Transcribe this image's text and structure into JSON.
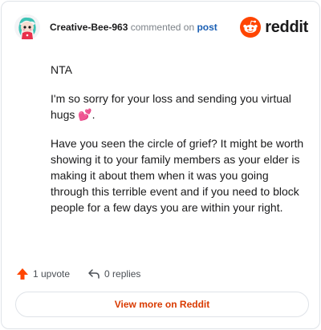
{
  "header": {
    "username": "Creative-Bee-963",
    "action_text": "commented on",
    "post_link": "post",
    "brand_name": "reddit"
  },
  "comment": {
    "paragraphs": [
      "NTA",
      "I'm so sorry for your loss and sending you virtual hugs 💕.",
      "Have you seen the circle of grief? It might be worth showing it to your family members as your elder is making it about them when it was you going through this terrible event and if you need to block people for a few days you are within your right."
    ]
  },
  "actions": {
    "upvotes": "1 upvote",
    "replies": "0 replies"
  },
  "footer": {
    "view_more_label": "View more on Reddit"
  },
  "colors": {
    "brand_orange": "#ff4500",
    "link_blue": "#1a5fb4",
    "cta_text": "#d93a00",
    "upvote_icon": "#ff4500"
  },
  "icons": {
    "avatar": "snoo-avatar-icon",
    "logo": "reddit-logo-icon",
    "upvote": "upvote-arrow-icon",
    "reply": "reply-arrow-icon"
  }
}
